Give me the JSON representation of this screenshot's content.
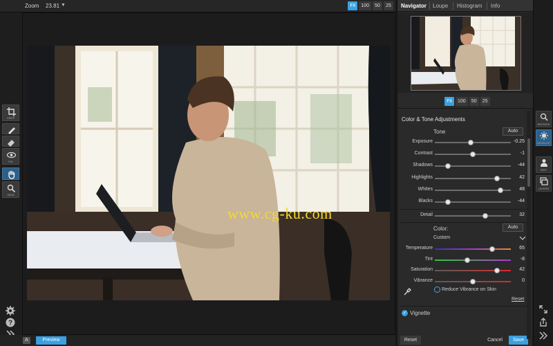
{
  "zoom_bar": {
    "label": "Zoom",
    "value": "23.81",
    "buttons": [
      "Fit",
      "100",
      "50",
      "25"
    ],
    "active": "Fit"
  },
  "tools": [
    {
      "name": "crop",
      "label": "CROP"
    },
    {
      "name": "fix",
      "label": "FIX"
    },
    {
      "name": "view",
      "label": "VIEW"
    }
  ],
  "canvas": {
    "watermark": "www.cg-ku.com"
  },
  "bottom_bar": {
    "badge": "A",
    "preview_label": "Preview"
  },
  "panel": {
    "tabs": [
      "Navigator",
      "Loupe",
      "Histogram",
      "Info"
    ],
    "active_tab": "Navigator",
    "nav_zoom_buttons": [
      "Fit",
      "100",
      "50",
      "25"
    ],
    "section_title": "Color & Tone Adjustments",
    "tone": {
      "title": "Tone",
      "auto_label": "Auto",
      "sliders": [
        {
          "label": "Exposure",
          "value": "-0.25",
          "pos": 0.47
        },
        {
          "label": "Contrast",
          "value": "-1",
          "pos": 0.5
        },
        {
          "label": "Shadows",
          "value": "-44",
          "pos": 0.17
        },
        {
          "label": "Highlights",
          "value": "42",
          "pos": 0.82
        },
        {
          "label": "Whites",
          "value": "48",
          "pos": 0.86
        },
        {
          "label": "Blacks",
          "value": "-44",
          "pos": 0.17
        }
      ],
      "detail": {
        "label": "Detail",
        "value": "32",
        "pos": 0.66
      }
    },
    "color": {
      "title": "Color:",
      "auto_label": "Auto",
      "preset": "Custom",
      "sliders": [
        {
          "label": "Temperature",
          "value": "65",
          "pos": 0.75,
          "gradient": "linear-gradient(90deg,#2a36c8,#a23ec0,#e0902a)"
        },
        {
          "label": "Tint",
          "value": "-8",
          "pos": 0.43,
          "gradient": "linear-gradient(90deg,#2ec83a,#b03ad0)"
        },
        {
          "label": "Saturation",
          "value": "42",
          "pos": 0.82,
          "gradient": "linear-gradient(90deg,#5a5a5a,#d82c2c)"
        },
        {
          "label": "Vibrance",
          "value": "0",
          "pos": 0.5,
          "gradient": "linear-gradient(90deg,#5a5a5a,#c83030)"
        }
      ],
      "skin_option": "Reduce Vibrance on Skin",
      "reset_label": "Reset"
    },
    "vignette_label": "Vignette",
    "footer": {
      "reset": "Reset",
      "cancel": "Cancel",
      "save": "Save"
    }
  },
  "right_tools": [
    {
      "name": "browse",
      "label": "BROWSE"
    },
    {
      "name": "develop",
      "label": "DEVELOP"
    },
    {
      "name": "edit",
      "label": "EDIT"
    },
    {
      "name": "layers",
      "label": "LAYERS"
    }
  ],
  "colors": {
    "accent": "#3aa0e0",
    "watermark": "#f5d830",
    "panel_bg": "#2a2a2a"
  }
}
